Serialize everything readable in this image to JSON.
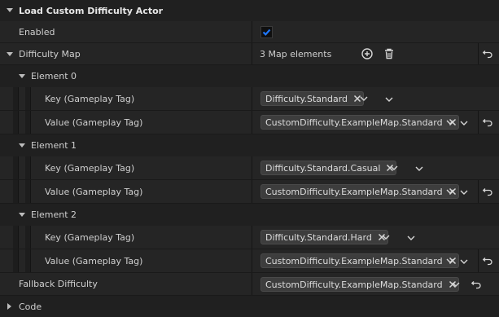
{
  "section": {
    "title": "Load Custom Difficulty Actor",
    "code_label": "Code"
  },
  "enabled": {
    "label": "Enabled",
    "checked": true
  },
  "difficulty_map": {
    "label": "Difficulty Map",
    "count_text": "3 Map elements",
    "elements": [
      {
        "label": "Element 0",
        "key_label": "Key (Gameplay Tag)",
        "key_tag": "Difficulty.Standard",
        "value_label": "Value (Gameplay Tag)",
        "value_tag": "CustomDifficulty.ExampleMap.Standard"
      },
      {
        "label": "Element 1",
        "key_label": "Key (Gameplay Tag)",
        "key_tag": "Difficulty.Standard.Casual",
        "value_label": "Value (Gameplay Tag)",
        "value_tag": "CustomDifficulty.ExampleMap.Standard"
      },
      {
        "label": "Element 2",
        "key_label": "Key (Gameplay Tag)",
        "key_tag": "Difficulty.Standard.Hard",
        "value_label": "Value (Gameplay Tag)",
        "value_tag": "CustomDifficulty.ExampleMap.Standard"
      }
    ]
  },
  "fallback": {
    "label": "Fallback Difficulty",
    "tag": "CustomDifficulty.ExampleMap.Standard"
  },
  "colors": {
    "accent": "#1f78ff",
    "background": "#1a1a1a"
  },
  "icons": [
    "add-icon",
    "trash-icon",
    "reset-arrow-icon",
    "close-icon",
    "chevron-down-icon",
    "expand-arrow-icon"
  ]
}
